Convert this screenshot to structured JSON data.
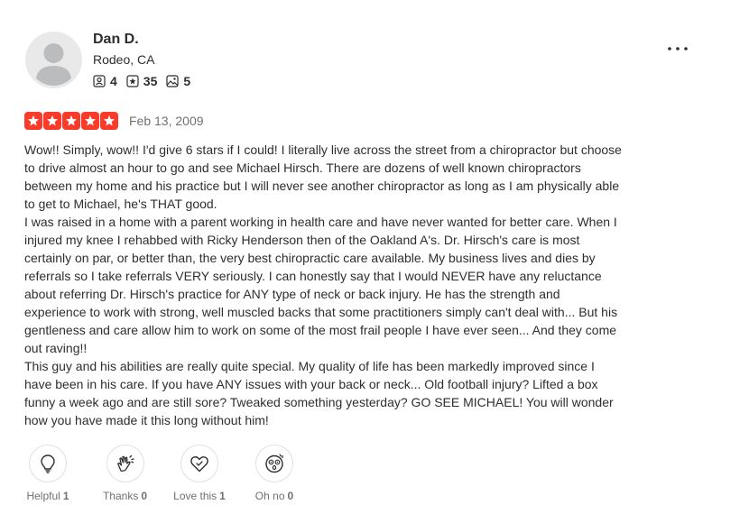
{
  "user": {
    "name": "Dan D.",
    "location": "Rodeo, CA",
    "friends": "4",
    "reviews": "35",
    "photos": "5"
  },
  "review": {
    "rating": 5,
    "date": "Feb 13, 2009",
    "paragraphs": [
      "Wow!! Simply, wow!! I'd give 6 stars if I could! I literally live across the street from a chiropractor but choose to drive almost an hour to go and see Michael Hirsch. There are dozens of well known chiropractors between my home and his practice but I will never see another chiropractor as long as I am physically able to get to Michael, he's THAT good.",
      "I was raised in a home with a parent working in health care and have never wanted for better care. When I injured my knee I rehabbed with Ricky Henderson then of the Oakland A's. Dr. Hirsch's care is most certainly on par, or better than, the very best chiropractic care available. My business lives and dies by referrals so I take referrals VERY seriously. I can honestly say that I would NEVER have any reluctance about referring Dr. Hirsch's practice for ANY type of neck or back injury. He has the strength and experience to work with strong, well muscled backs that some practitioners simply can't deal with... But his gentleness and care allow him to work on some of the most frail people I have ever seen... And they come out raving!!",
      "This guy and his abilities are really quite special. My quality of life has been markedly improved since I have been in his care. If you have ANY issues with your back or neck... Old football injury? Lifted a box funny a week ago and are still sore? Tweaked something yesterday? GO SEE MICHAEL! You will wonder how you have made it this long without him!"
    ]
  },
  "reactions": [
    {
      "label": "Helpful",
      "count": "1",
      "icon": "lightbulb-icon"
    },
    {
      "label": "Thanks",
      "count": "0",
      "icon": "clapping-hands-icon"
    },
    {
      "label": "Love this",
      "count": "1",
      "icon": "heart-icon"
    },
    {
      "label": "Oh no",
      "count": "0",
      "icon": "shocked-face-icon"
    }
  ],
  "colors": {
    "star": "#fb3b2a",
    "text": "#2d2e2f",
    "muted": "#6e7072"
  }
}
